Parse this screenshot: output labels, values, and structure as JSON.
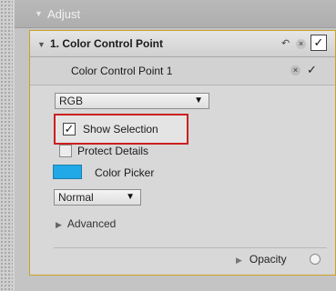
{
  "adjust": {
    "title": "Adjust",
    "toggle_glyph": "▼"
  },
  "ccp": {
    "title": "1. Color Control Point",
    "toggle_glyph": "▼",
    "header_undo_glyph": "↶",
    "header_close_glyph": "×",
    "header_checkbox_glyph": "✓",
    "point": {
      "label": "Color Control Point 1",
      "close_glyph": "×",
      "check_glyph": "✓"
    },
    "mode_dropdown": {
      "value": "RGB",
      "caret": "▼"
    },
    "show_selection": {
      "label": "Show Selection",
      "checked": true,
      "glyph": "✓"
    },
    "protect_details": {
      "label": "Protect Details",
      "checked": false
    },
    "color_picker": {
      "label": "Color Picker",
      "color": "#21a8e6"
    },
    "blend_dropdown": {
      "value": "Normal",
      "caret": "▼"
    },
    "advanced": {
      "label": "Advanced",
      "glyph": "▶"
    },
    "opacity": {
      "label": "Opacity",
      "glyph": "▶"
    }
  },
  "colors": {
    "highlight_border": "#cc1f1f",
    "panel_outline": "#c9a227",
    "swatch": "#21a8e6"
  }
}
